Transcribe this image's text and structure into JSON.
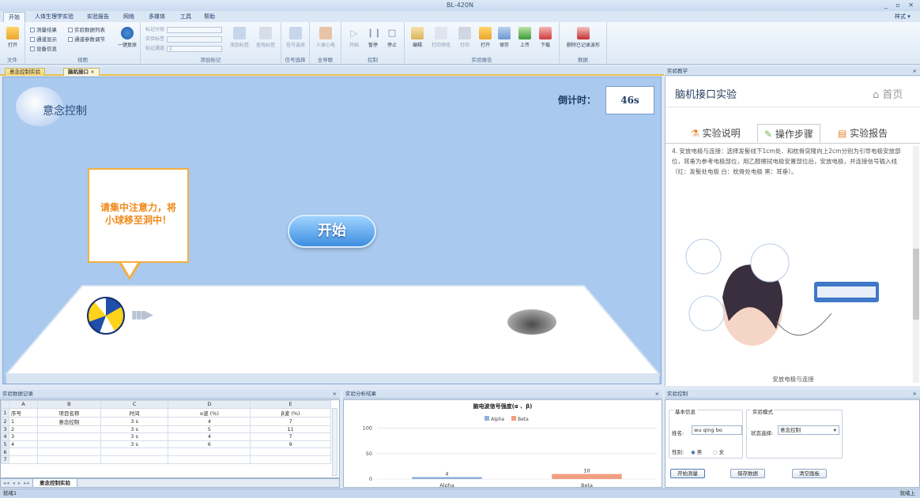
{
  "window": {
    "title": "BL-420N",
    "controls": "_ ▫ ✕"
  },
  "menu": {
    "items": [
      "开始",
      "人体生理学实验",
      "实验报告",
      "网络",
      "多媒体",
      "工具",
      "帮助"
    ],
    "style": "样式 ▾"
  },
  "ribbon": {
    "open": "打开",
    "file_group": "文件",
    "view_checks": [
      "测量结果",
      "通道显示",
      "设备信息",
      "实验数据列表",
      "通道参数调节"
    ],
    "one_key": "一键复原",
    "view_group": "视图",
    "mark_fields": [
      "标记分组",
      "实验标签",
      "标记通道"
    ],
    "mark_channel_value": "1",
    "add_mark": "添加标签",
    "find_mark": "查找标签",
    "mark_group": "添加标记",
    "signal_select": "信号选择",
    "signal_group": "信号选择",
    "human_heart": "人体心电",
    "guide_group": "全导联",
    "start": "开始",
    "pause": "暂停",
    "stop": "停止",
    "control_group": "控制",
    "edit": "编辑",
    "print_preview": "打印预览",
    "print": "打印",
    "open2": "打开",
    "save": "保存",
    "upload": "上传",
    "download": "下载",
    "report_group": "实验报告",
    "delete_waves": "删除已记录波形",
    "data_group": "数据"
  },
  "doc_tabs": [
    "意念控制实验",
    "脑机接口"
  ],
  "game": {
    "logo_text": "意念控制",
    "countdown_label": "倒计时：",
    "countdown_value": "46s",
    "bubble_text": "请集中注意力，将小球移至洞中！",
    "start_button": "开始"
  },
  "teach": {
    "panel_title": "实验教学",
    "title": "脑机接口实验",
    "home": "首页",
    "tabs": [
      "实验说明",
      "操作步骤",
      "实验报告"
    ],
    "step_text": "4. 安放电极与连接：选择发髻线下1cm处、和枕骨突隆向上2cm分别为引导电极安放部位，耳垂为参考电极部位，用乙醇擦拭电极安置部位后，安放电极，并连接信号输入线（红：发髻处电极  白：枕骨处电极  黑：耳垂）。",
    "figure_caption": "安放电极与连接"
  },
  "records": {
    "panel_title": "实验数据记录",
    "col_letters": [
      "A",
      "B",
      "C",
      "D",
      "E"
    ],
    "header": [
      "序号",
      "项目名称",
      "时间",
      "α波 (%)",
      "β波 (%)"
    ],
    "rows": [
      [
        "1",
        "意念控制",
        "3 s",
        "4",
        "7"
      ],
      [
        "2",
        "",
        "3 s",
        "5",
        "11"
      ],
      [
        "3",
        "",
        "3 s",
        "4",
        "7"
      ],
      [
        "4",
        "",
        "3 s",
        "6",
        "9"
      ]
    ],
    "row_numbers": [
      "1",
      "2",
      "3",
      "4",
      "5",
      "6",
      "7"
    ],
    "sheet_tab": "意念控制实验"
  },
  "analysis": {
    "panel_title": "实验分析结果"
  },
  "chart_data": {
    "type": "bar",
    "title": "脑电波信号强度(α 、β)",
    "categories": [
      "Alpha",
      "Beta"
    ],
    "series": [
      {
        "name": "Alpha",
        "values": [
          4,
          null
        ]
      },
      {
        "name": "Beta",
        "values": [
          null,
          10
        ]
      }
    ],
    "data_labels": [
      "4",
      "10"
    ],
    "yticks": [
      "0",
      "50",
      "100"
    ],
    "ylim": [
      0,
      100
    ],
    "legend_position": "top",
    "colors": {
      "Alpha": "#8eb0db",
      "Beta": "#f0a080"
    }
  },
  "control": {
    "panel_title": "实验控制",
    "basic_info": "基本信息",
    "name_label": "姓名:",
    "name_value": "wu qing bo",
    "gender_label": "性别:",
    "male": "男",
    "female": "女",
    "mode_title": "实验模式",
    "state_label": "状态选择:",
    "state_value": "意念控制",
    "start_measure": "开始测量",
    "save_data": "保存数据",
    "clear_canvas": "清空画板"
  },
  "status": {
    "left": "就绪1",
    "right": "就绪上"
  }
}
